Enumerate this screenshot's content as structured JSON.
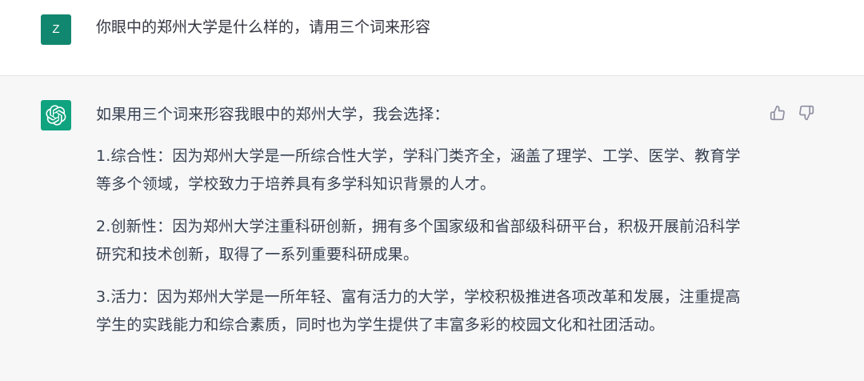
{
  "user_message": {
    "avatar_letter": "Z",
    "text": "你眼中的郑州大学是什么样的，请用三个词来形容"
  },
  "assistant_message": {
    "intro": "如果用三个词来形容我眼中的郑州大学，我会选择：",
    "points": [
      "1.综合性：因为郑州大学是一所综合性大学，学科门类齐全，涵盖了理学、工学、医学、教育学等多个领域，学校致力于培养具有多学科知识背景的人才。",
      "2.创新性：因为郑州大学注重科研创新，拥有多个国家级和省部级科研平台，积极开展前沿科学研究和技术创新，取得了一系列重要科研成果。",
      "3.活力：因为郑州大学是一所年轻、富有活力的大学，学校积极推进各项改革和发展，注重提高学生的实践能力和综合素质，同时也为学生提供了丰富多彩的校园文化和社团活动。"
    ]
  },
  "icons": {
    "assistant_avatar": "openai-logo-icon",
    "thumbs_up": "thumbs-up-icon",
    "thumbs_down": "thumbs-down-icon"
  },
  "colors": {
    "user_avatar_bg": "#12876f",
    "assistant_avatar_bg": "#10a37f",
    "assistant_bg": "#f7f7f8"
  }
}
